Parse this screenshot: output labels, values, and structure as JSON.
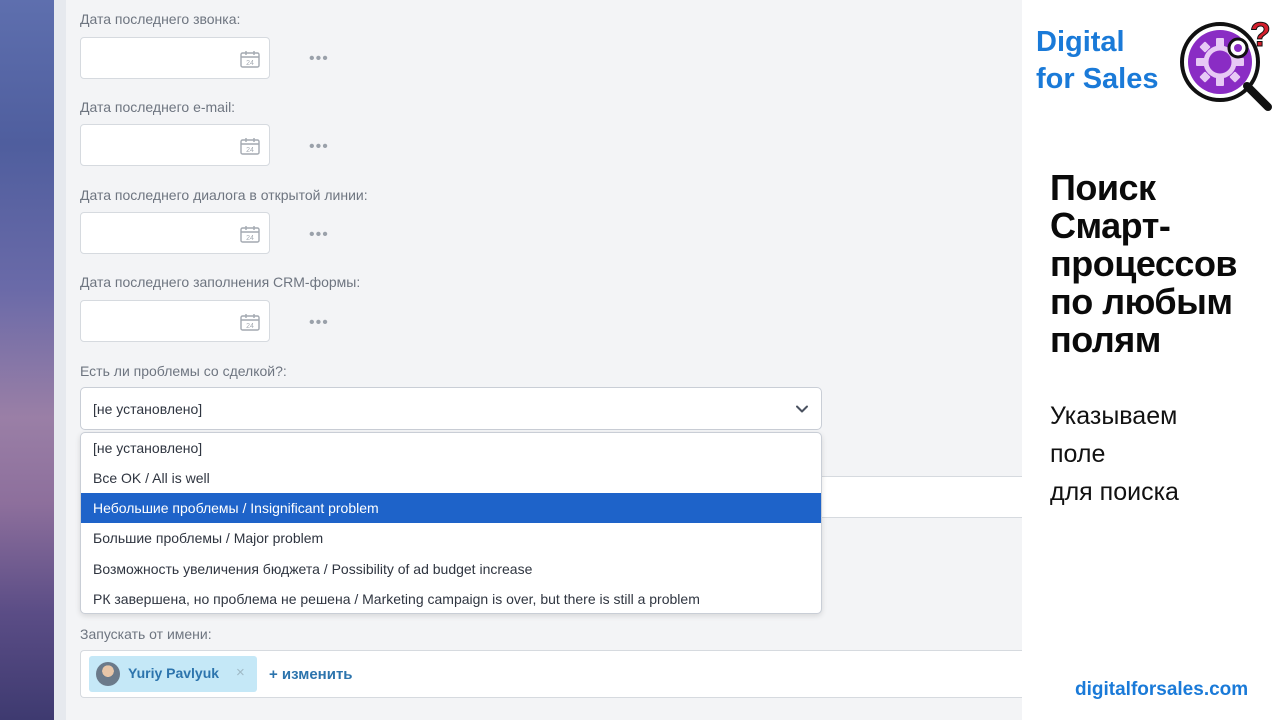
{
  "fields": [
    {
      "label": "Дата последнего звонка:"
    },
    {
      "label": "Дата последнего e-mail:"
    },
    {
      "label": "Дата последнего диалога в открытой линии:"
    },
    {
      "label": "Дата последнего заполнения CRM-формы:"
    }
  ],
  "calendar_day": "24",
  "more_dots": "•••",
  "problem_field": {
    "label": "Есть ли проблемы со сделкой?:",
    "value": "[не установлено]",
    "options": [
      "[не установлено]",
      "Все OK / All is well",
      "Небольшие проблемы / Insignificant problem",
      "Большие проблемы / Major problem",
      "Возможность увеличения бюджета / Possibility of ad budget increase",
      "РК завершена, но проблема не решена / Marketing campaign is over, but there is still a problem"
    ],
    "highlighted_index": 2
  },
  "run_as": {
    "label": "Запускать от имени:",
    "user": "Yuriy Pavlyuk",
    "remove": "×",
    "change": "+ изменить"
  },
  "promo": {
    "brand_line1": "Digital",
    "brand_line2": "for Sales",
    "title_lines": [
      "Поиск",
      "Смарт-",
      "процессов",
      "по любым",
      "полям"
    ],
    "subtitle_lines": [
      "Указываем",
      "поле",
      "для поиска"
    ],
    "website": "digitalforsales.com"
  },
  "colors": {
    "accent": "#1e63c9",
    "brand": "#1a7ad8",
    "logo_purple": "#8a2cc4",
    "logo_red": "#d41f2c"
  }
}
